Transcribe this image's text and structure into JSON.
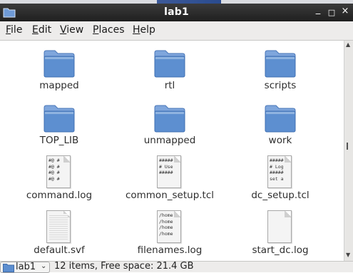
{
  "window": {
    "title": "lab1",
    "min_glyph": "_",
    "max_glyph": "□",
    "close_glyph": "×"
  },
  "menu": [
    {
      "label": "File",
      "underline": "F"
    },
    {
      "label": "Edit",
      "underline": "E"
    },
    {
      "label": "View",
      "underline": "V"
    },
    {
      "label": "Places",
      "underline": "P"
    },
    {
      "label": "Help",
      "underline": "H"
    }
  ],
  "items": [
    {
      "name": "mapped",
      "kind": "folder"
    },
    {
      "name": "rtl",
      "kind": "folder"
    },
    {
      "name": "scripts",
      "kind": "folder"
    },
    {
      "name": "TOP_LIB",
      "kind": "folder"
    },
    {
      "name": "unmapped",
      "kind": "folder"
    },
    {
      "name": "work",
      "kind": "folder"
    },
    {
      "name": "command.log",
      "kind": "text",
      "preview": "#@ #\n#@ #\n#@ #\n#@ #"
    },
    {
      "name": "common_setup.tcl",
      "kind": "text",
      "preview": "#####\n# Use\n#####"
    },
    {
      "name": "dc_setup.tcl",
      "kind": "text",
      "preview": "#####\n# Log\n#####\nset a"
    },
    {
      "name": "default.svf",
      "kind": "blank-lines",
      "preview": ""
    },
    {
      "name": "filenames.log",
      "kind": "text",
      "preview": "/home\n/home\n/home\n/home"
    },
    {
      "name": "start_dc.log",
      "kind": "blank",
      "preview": ""
    }
  ],
  "statusbar": {
    "location": "lab1",
    "info": "12 items, Free space: 21.4 GB"
  },
  "colors": {
    "folder_top": "#8fb3e0",
    "folder_body": "#5d8fd0",
    "titlebar": "#2b2b2b",
    "menubar": "#edeceb"
  }
}
